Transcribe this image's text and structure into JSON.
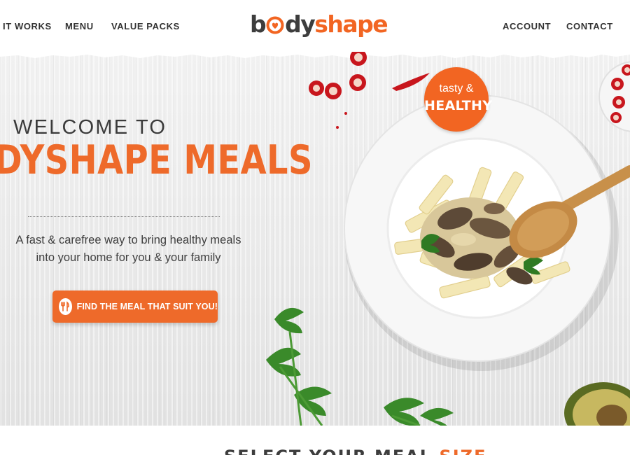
{
  "nav": {
    "left": [
      {
        "id": "how-it-works",
        "label": "IT WORKS"
      },
      {
        "id": "menu",
        "label": "MENU"
      },
      {
        "id": "value-packs",
        "label": "VALUE PACKS"
      }
    ],
    "right": [
      {
        "id": "account",
        "label": "ACCOUNT"
      },
      {
        "id": "contact",
        "label": "CONTACT"
      }
    ]
  },
  "logo": {
    "part1": "b",
    "part2": "dy",
    "part3": "shape",
    "heart_icon": "heart-o-icon"
  },
  "hero": {
    "welcome": "WELCOME TO",
    "title": "DYSHAPE MEALS",
    "tagline_line1": "A fast & carefree way to bring healthy meals",
    "tagline_line2": "into your home for you & your family",
    "cta_label": "FIND THE MEAL THAT SUIT YOU!",
    "cta_icon": "fork-knife-icon"
  },
  "badge": {
    "top": "tasty &",
    "bottom": "HEALTHY"
  },
  "section": {
    "title_main": "SELECT YOUR MEAL",
    "title_accent": "SIZE"
  },
  "colors": {
    "brand_orange": "#f26522",
    "text_dark": "#3d3d3d",
    "hero_bg": "#ececec"
  }
}
